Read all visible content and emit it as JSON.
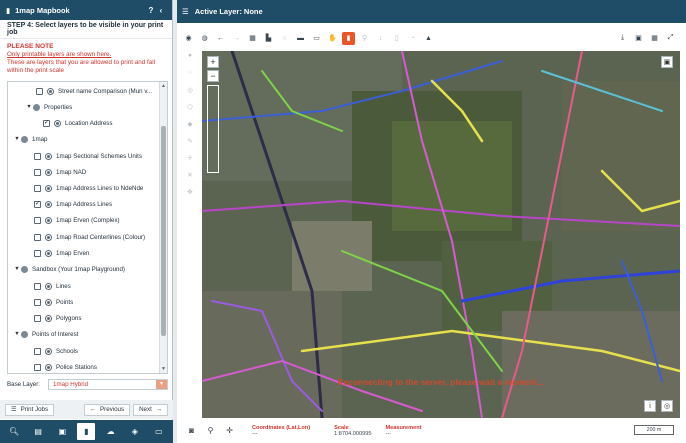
{
  "left_panel": {
    "title": "1map Mapbook",
    "help": "?",
    "collapse": "‹",
    "step": "STEP 4: Select layers to be visible in your print job",
    "note_title": "PLEASE NOTE",
    "note_line1": "Only printable layers are shown here.",
    "note_line2": "These are layers that you are allowed to print and fall",
    "note_line3": "within the print scale",
    "tree": [
      {
        "label": "Street name Comparison (Mun v..."
      },
      {
        "label": "Properties"
      },
      {
        "label": "Location Address"
      },
      {
        "label": "1map"
      },
      {
        "label": "1map Sectional Schemes Units"
      },
      {
        "label": "1map NAD"
      },
      {
        "label": "1map Address Lines to NdeNde"
      },
      {
        "label": "1map Address Lines"
      },
      {
        "label": "1map Erven (Complex)"
      },
      {
        "label": "1map Road Centerlines (Colour)"
      },
      {
        "label": "1map Erven"
      },
      {
        "label": "Sandbox (Your 1map Playground)"
      },
      {
        "label": "Lines"
      },
      {
        "label": "Points"
      },
      {
        "label": "Polygons"
      },
      {
        "label": "Points of Interest"
      },
      {
        "label": "Schools"
      },
      {
        "label": "Police Stations"
      }
    ],
    "base_layer_label": "Base Layer:",
    "base_layer_value": "1map Hybrid",
    "print_jobs": "Print Jobs",
    "previous": "Previous",
    "next": "Next"
  },
  "map_panel": {
    "title": "Active Layer: None",
    "watermark": "Reconnecting to the server, please wait a moment...",
    "coordinates_label": "Coordinates (Lat,Lon)",
    "coordinates_value": "---",
    "scale_label": "Scale",
    "scale_value": "1:8704.000995",
    "measurement_label": "Measurement",
    "measurement_value": "---",
    "scale_bar": "200 m"
  },
  "colors": {
    "header": "#1f4c66",
    "note_red": "#d3332c",
    "tool_active": "#e8562a"
  }
}
